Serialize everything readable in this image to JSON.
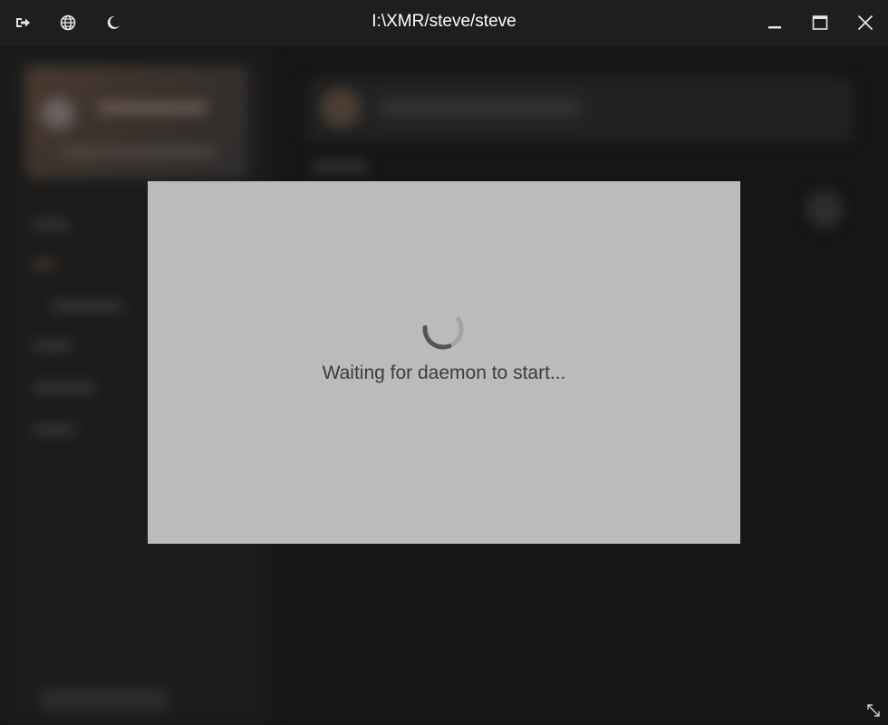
{
  "window": {
    "title": "I:\\XMR/steve/steve"
  },
  "titlebar": {
    "left_icons": [
      "logout-icon",
      "globe-icon",
      "moon-icon"
    ],
    "right_icons": [
      "minimize-icon",
      "maximize-icon",
      "close-icon"
    ]
  },
  "modal": {
    "message": "Waiting for daemon to start..."
  },
  "colors": {
    "titlebar_bg": "#1e1e1e",
    "app_bg": "#161616",
    "modal_bg": "#bbbbbb",
    "modal_text": "#3c3c3c",
    "title_text": "#ffffff"
  }
}
